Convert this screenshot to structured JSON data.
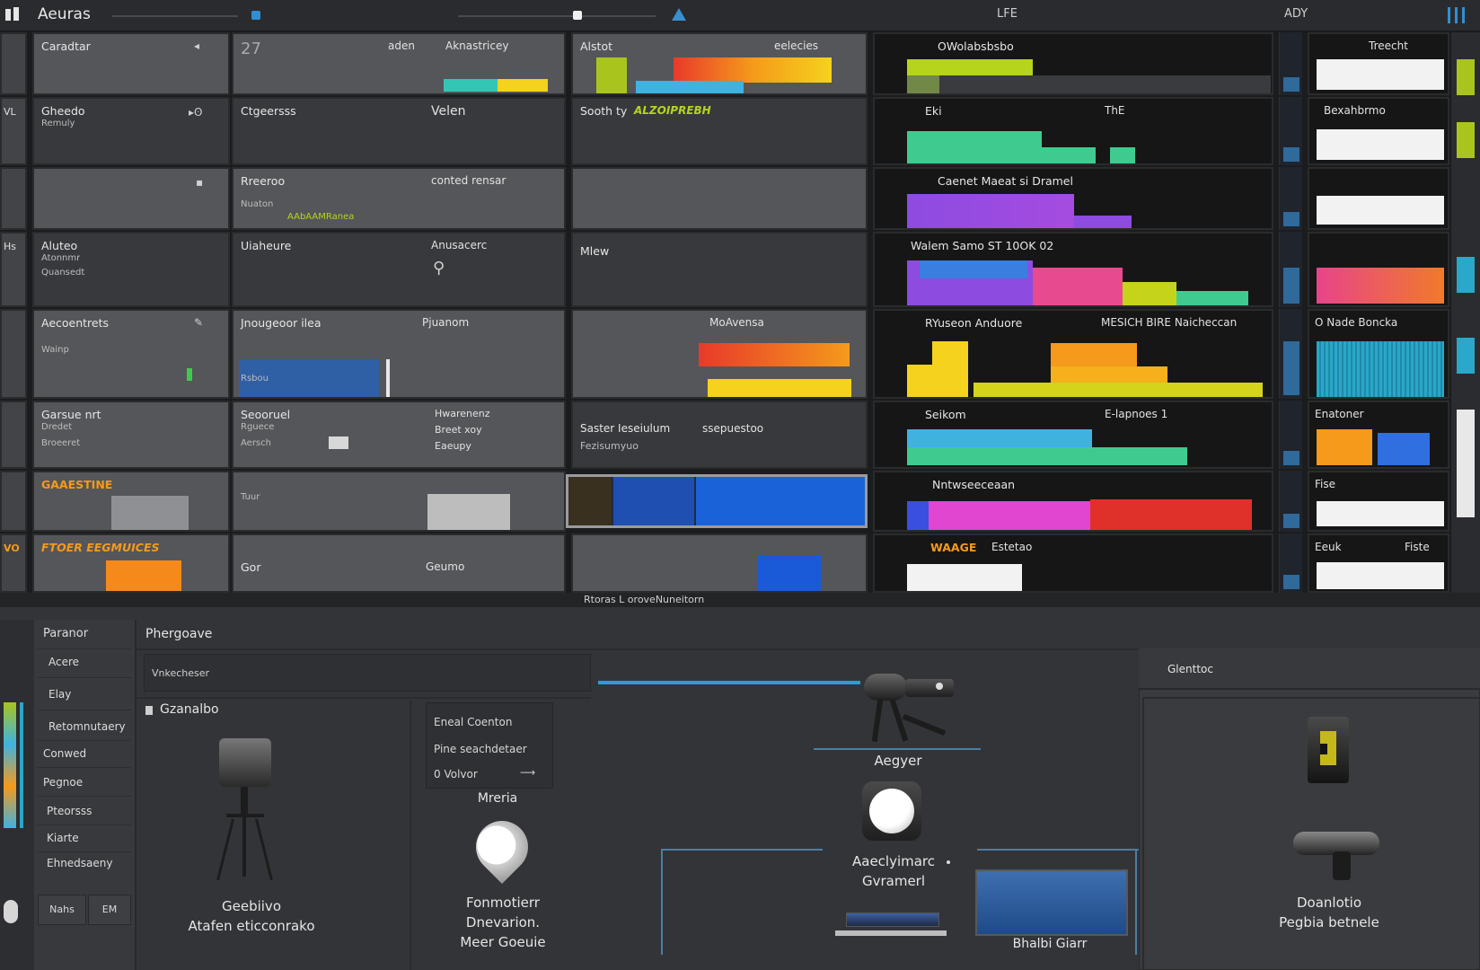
{
  "titlebar": {
    "app_title": "Aeuras",
    "center_text": "LFE",
    "right_text": "ADY"
  },
  "grid": {
    "row0": {
      "c1_label": "Caradtar",
      "c2_label_a": "27",
      "c2_label_b": "aden",
      "c2_label_c": "Aknastricey",
      "c3_label_a": "Alstot",
      "c3_label_b": "eelecies",
      "c4_label": "OWolabsbsbo",
      "c6_label": "Treecht"
    },
    "row1": {
      "c0_label": "VL",
      "c1_label": "Gheedo",
      "c1_sub": "Remuly",
      "c2_label_a": "Ctgeersss",
      "c2_label_b": "Velen",
      "c3_label_a": "Sooth ty",
      "c3_label_b": "ALZOIPREBH",
      "c4_label": "Eki",
      "c4_label_b": "ThE",
      "c6_label": "Bexahbrmo"
    },
    "row2": {
      "c2_label_a": "Rreeroo",
      "c2_label_b": "conted rensar",
      "c2_sub_a": "Nuaton",
      "c2_sub_b": "AAbAAMRanea",
      "c4_label": "Caenet  Maeat si Dramel"
    },
    "row3": {
      "c0_label": "Hs",
      "c1_label": "Aluteo",
      "c1_sub_a": "Atonnmr",
      "c1_sub_b": "Quansedt",
      "c2_label_a": "Uiaheure",
      "c2_label_b": "Anusacerc",
      "c3_label": "Mlew",
      "c4_label": "Walem Samo ST 10OK 02"
    },
    "row4": {
      "c1_label": "Aecoentrets",
      "c1_sub": "Wainp",
      "c2_label_a": "Jnougeoor ilea",
      "c2_label_b": "Pjuanom",
      "c2_sub": "Rsbou",
      "c3_label": "MoAvensa",
      "c4_label_a": "RYuseon  Anduore",
      "c4_label_b": "MESICH BIRE  Naicheccan",
      "c6_label": "O Nade Boncka"
    },
    "row5": {
      "c1_label": "Garsue nrt",
      "c1_sub_a": "Dredet",
      "c1_sub_b": "Broeeret",
      "c2_label_a": "Seooruel",
      "c2_sub_a": "Rguece",
      "c2_sub_b": "Aersch",
      "c2_label_b": "Hwarenenz",
      "c2_sub_c": "Breet xoy",
      "c2_sub_d": "Eaeupy",
      "c3_label_a": "Saster Ieseiulum",
      "c3_label_b": "ssepuestoo",
      "c3_sub": "Fezisumyuo",
      "c4_label_a": "Seikom",
      "c4_label_b": "E-lapnoes 1",
      "c6_label": "Enatoner"
    },
    "row6": {
      "c1_label": "GAAESTINE",
      "c2_label": "Tuur",
      "c4_label": "Nntwseeceaan",
      "c6_label": "Fise"
    },
    "row7": {
      "c0_label": "VO",
      "c1_label": "FTOER EEGMUICES",
      "c2_label_a": "Gor",
      "c2_label_b": "Geumo",
      "c4_label_a": "WAAGE",
      "c4_label_b": "Estetao",
      "c6_label_a": "Eeuk",
      "c6_label_b": "Fiste"
    }
  },
  "statusline": {
    "text": "Rtoras L oroveNuneitorn"
  },
  "sidebar": {
    "header": "Paranor",
    "items": [
      "Acere",
      "Elay",
      "Retomnutaery",
      "Conwed",
      "Pegnoe",
      "Pteorsss",
      "Kiarte",
      "Ehnedsaeny"
    ],
    "btn_left": "Nahs",
    "btn_right": "EM"
  },
  "workspace": {
    "prop_title": "Phergoave",
    "prop_field": "Vnkecheser",
    "section_title": "Gzanalbo",
    "mini_panel": [
      "Eneal Coenton",
      "Pine  seachdetaer",
      "0 Volvor"
    ],
    "node_camera": {
      "line1": "Geebiivo",
      "line2": "Atafen eticconrako"
    },
    "node_meria": "Mreria",
    "node_pin": {
      "line1": "Fonmotierr",
      "line2": "Dnevarion.",
      "line3": "Meer Goeuie"
    },
    "node_agyer": "Aegyer",
    "node_white": {
      "line1": "Aaeclyimarc",
      "line2": "Gvramerl"
    },
    "node_blue": "Bhalbi Giarr",
    "right_header": "Glenttoc",
    "node_right": {
      "line1": "Doanlotio",
      "line2": "Pegbia betnele"
    }
  }
}
